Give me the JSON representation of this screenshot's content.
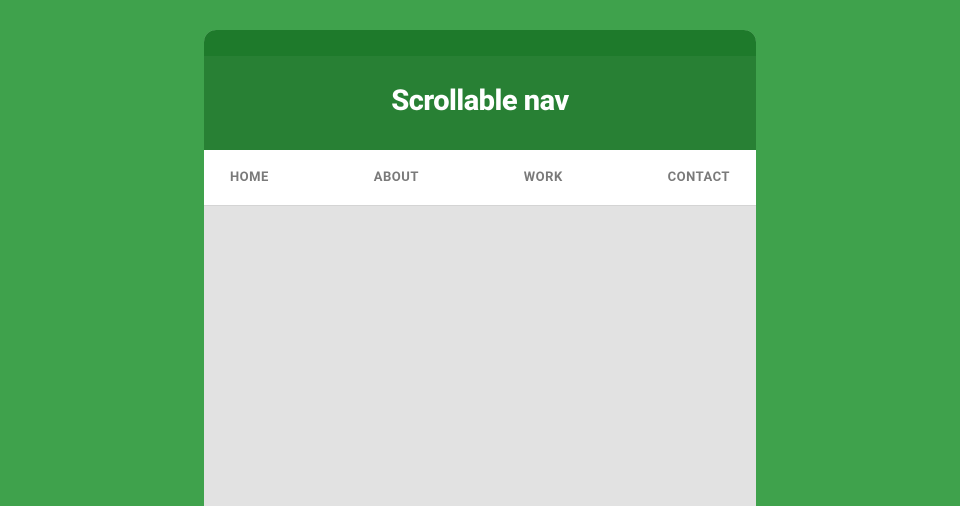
{
  "header": {
    "title": "Scrollable nav"
  },
  "nav": {
    "items": [
      {
        "label": "HOME"
      },
      {
        "label": "ABOUT"
      },
      {
        "label": "WORK"
      },
      {
        "label": "CONTACT"
      }
    ]
  }
}
